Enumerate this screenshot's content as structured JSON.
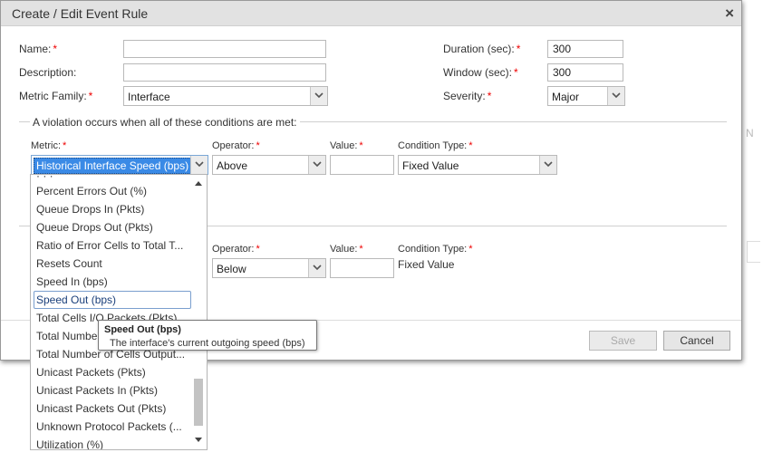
{
  "dialog": {
    "title": "Create / Edit Event Rule",
    "close_symbol": "×"
  },
  "form": {
    "name_label": "Name:",
    "name_value": "",
    "description_label": "Description:",
    "description_value": "",
    "metric_family_label": "Metric Family:",
    "metric_family_value": "Interface",
    "duration_label": "Duration (sec):",
    "duration_value": "300",
    "window_label": "Window (sec):",
    "window_value": "300",
    "severity_label": "Severity:",
    "severity_value": "Major",
    "required_marker": "*"
  },
  "conditions": {
    "legend": "A violation occurs when all of these conditions are met:",
    "metric_label": "Metric:",
    "operator_label": "Operator:",
    "value_label": "Value:",
    "condition_type_label": "Condition Type:",
    "row1": {
      "metric": "Historical Interface Speed (bps)",
      "operator": "Above",
      "value": "",
      "condition_type": "Fixed Value"
    },
    "row2": {
      "operator": "Below",
      "value": "",
      "condition_type": "Fixed Value"
    }
  },
  "dropdown": {
    "items": [
      "Percent Errors Out (%)",
      "Queue Drops In (Pkts)",
      "Queue Drops Out (Pkts)",
      "Ratio of Error Cells to Total T...",
      "Resets Count",
      "Speed In (bps)",
      "Speed Out (bps)",
      "Total Cells I/O Packets (Pkts)",
      "Total Number...",
      "Total Number of Cells Output...",
      "Unicast Packets (Pkts)",
      "Unicast Packets In (Pkts)",
      "Unicast Packets Out (Pkts)",
      "Unknown Protocol Packets (...",
      "Utilization (%)"
    ],
    "highlighted": "Speed Out (bps)",
    "scroll_position": 0.85
  },
  "tooltip": {
    "title": "Speed Out (bps)",
    "body": "The interface's current outgoing speed (bps)"
  },
  "buttons": {
    "save": "Save",
    "cancel": "Cancel"
  },
  "icons": {
    "close": "close-icon",
    "dropdown_arrow": "chevron-down-icon",
    "scroll_up": "scroll-up-arrow-icon",
    "scroll_down": "scroll-down-arrow-icon"
  },
  "colors": {
    "selected_highlight": "#3a8ae6",
    "required": "#e00000",
    "titlebar": "#e2e2e2"
  }
}
